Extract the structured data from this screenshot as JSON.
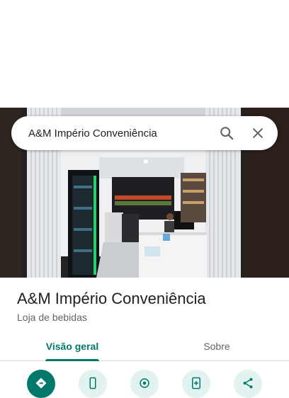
{
  "search": {
    "query": "A&M Império Conveniência"
  },
  "place": {
    "name": "A&M Império Conveniência",
    "category": "Loja de bebidas"
  },
  "tabs": [
    {
      "label": "Visão geral",
      "active": true
    },
    {
      "label": "Sobre",
      "active": false
    }
  ],
  "actions": [
    {
      "icon": "directions-icon"
    },
    {
      "icon": "phone-icon"
    },
    {
      "icon": "location-icon"
    },
    {
      "icon": "save-icon"
    },
    {
      "icon": "share-icon"
    }
  ],
  "colors": {
    "accent": "#00796b",
    "accent_light": "#e2f2f0"
  }
}
